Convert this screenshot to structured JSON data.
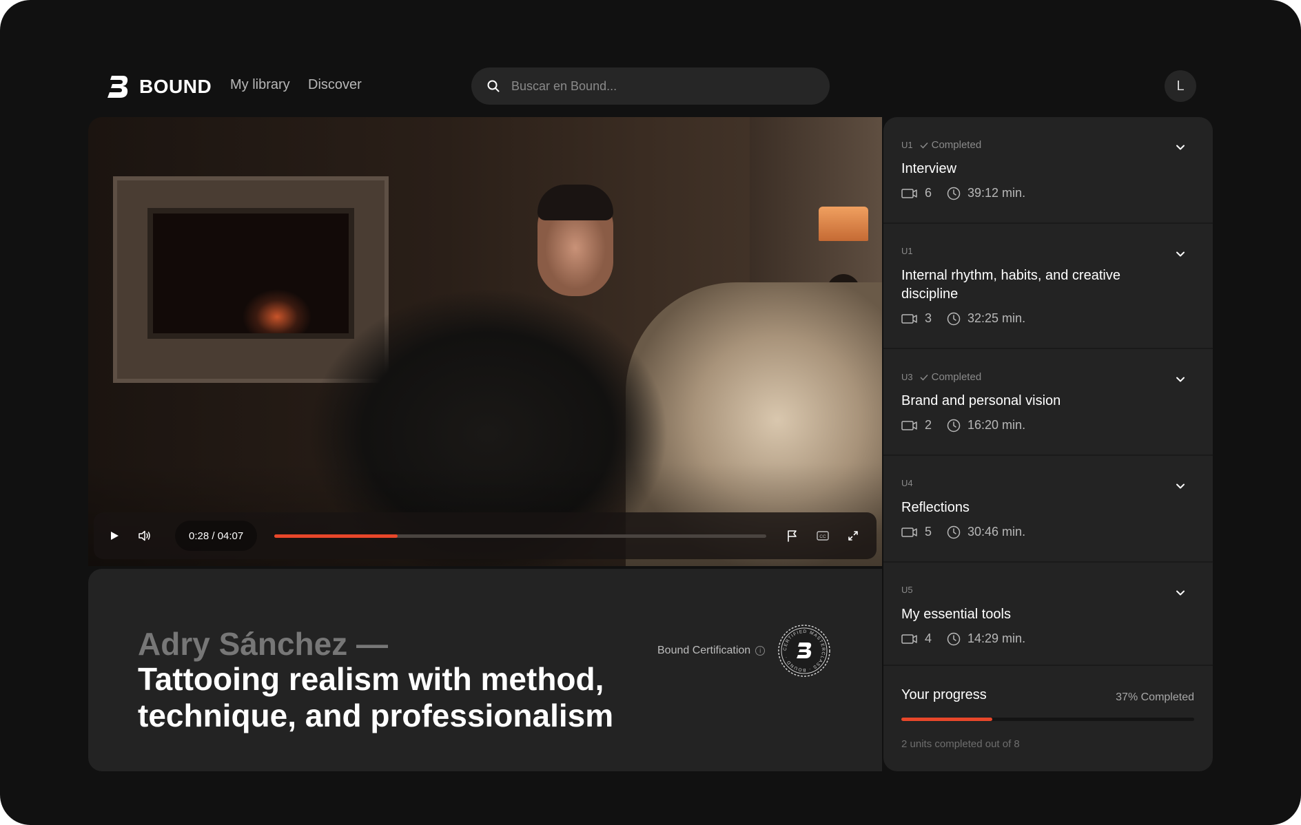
{
  "app": {
    "brand": "BOUND"
  },
  "nav": {
    "links": [
      "My library",
      "Discover"
    ]
  },
  "search": {
    "placeholder": "Buscar en Bound..."
  },
  "user": {
    "initial": "L"
  },
  "player": {
    "time": "0:28 / 04:07",
    "progress_fraction": 0.25,
    "icons": [
      "play-icon",
      "volume-icon",
      "flag-icon",
      "captions-icon",
      "fullscreen-icon"
    ],
    "accent_color": "#e8472a"
  },
  "course": {
    "instructor": "Adry Sánchez —",
    "title": "Tattooing realism with method, technique, and professionalism",
    "certification_label": "Bound Certification",
    "seal_text": "CERTIFIED MASTERCLASS · BOUND ·"
  },
  "units": [
    {
      "code": "U1",
      "status": "Completed",
      "title": "Interview",
      "videos": "6",
      "duration": "39:12 min."
    },
    {
      "code": "U1",
      "status": "",
      "title": "Internal rhythm, habits, and creative discipline",
      "videos": "3",
      "duration": "32:25 min."
    },
    {
      "code": "U3",
      "status": "Completed",
      "title": "Brand and personal vision",
      "videos": "2",
      "duration": "16:20 min."
    },
    {
      "code": "U4",
      "status": "",
      "title": "Reflections",
      "videos": "5",
      "duration": "30:46 min."
    },
    {
      "code": "U5",
      "status": "",
      "title": "My essential tools",
      "videos": "4",
      "duration": "14:29 min."
    }
  ],
  "progress": {
    "title": "Your progress",
    "percent_label": "37% Completed",
    "fraction": 0.31,
    "note": "2 units completed out of 8"
  }
}
